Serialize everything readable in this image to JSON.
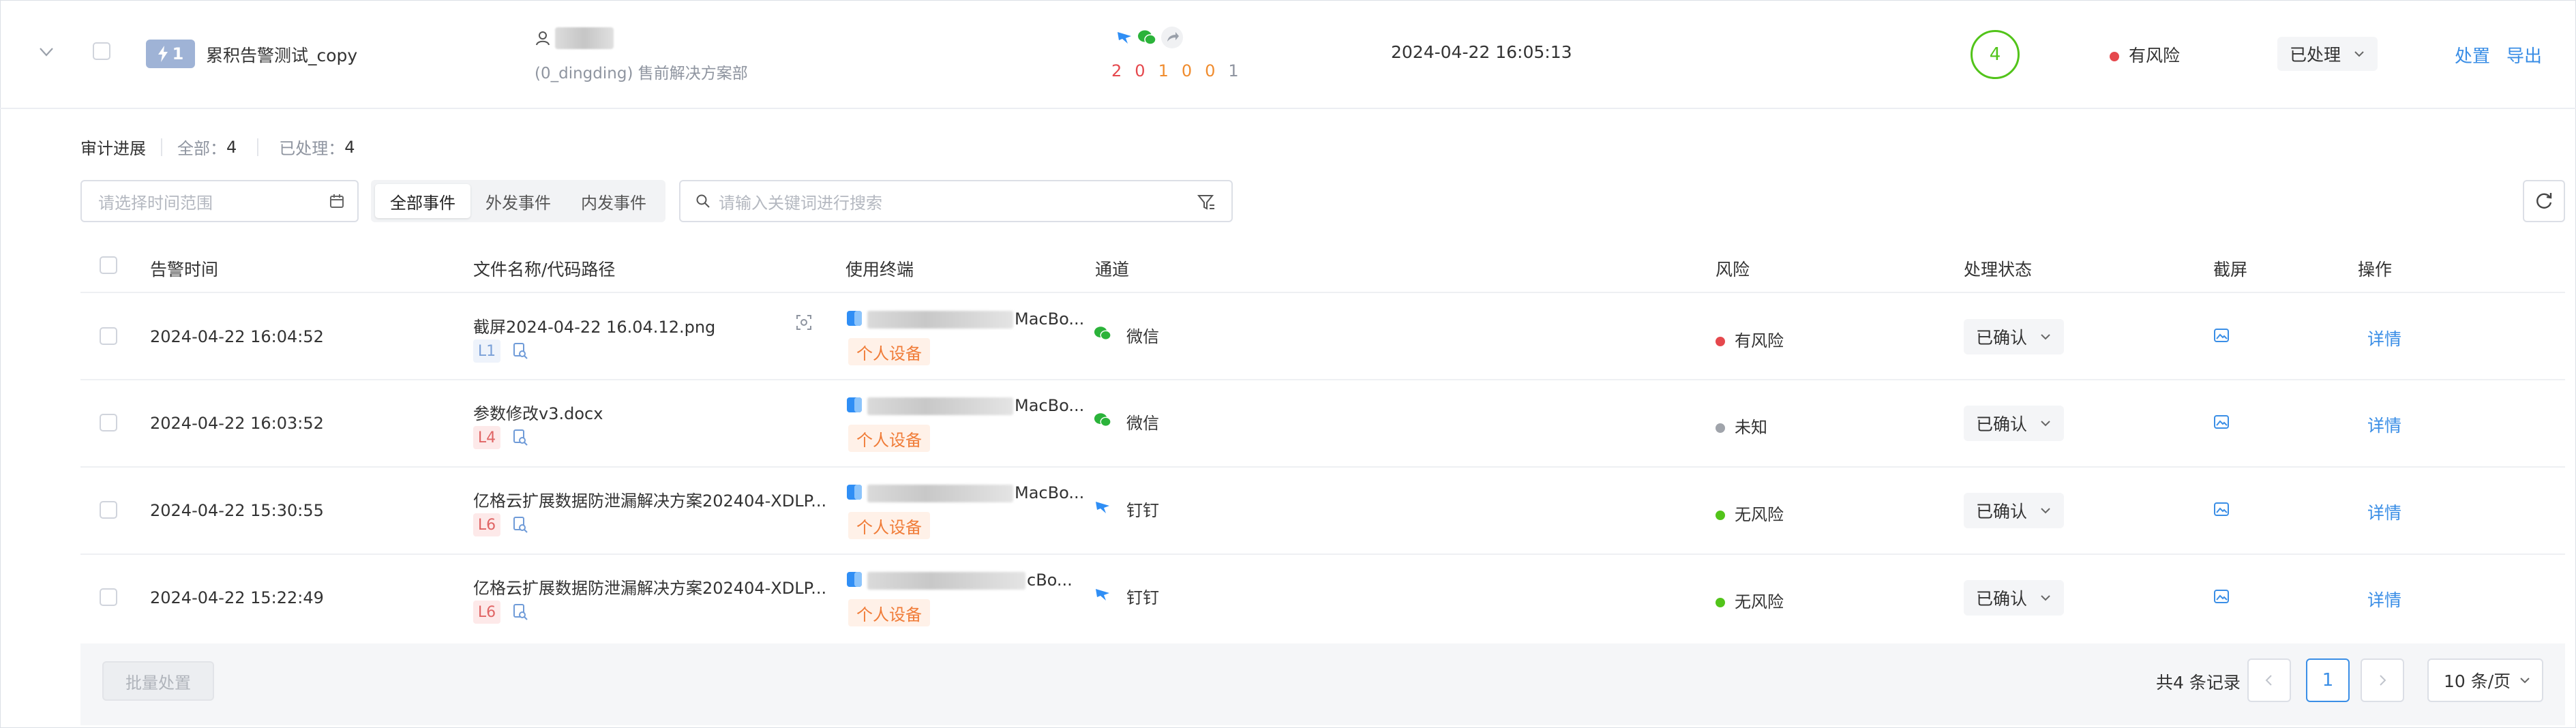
{
  "summary": {
    "level_badge": "1",
    "rule_name": "累积告警测试_copy",
    "dept": "(0_dingding) 售前解决方案部",
    "channel_counts": [
      "2",
      "0",
      "1",
      "0",
      "0",
      "1"
    ],
    "channel_count_colors": [
      "#e5484d",
      "#e5484d",
      "#f08c2e",
      "#f08c2e",
      "#f08c2e",
      "#8f95a0"
    ],
    "time": "2024-04-22 16:05:13",
    "event_count": "4",
    "risk": "有风险",
    "risk_color": "#e5484d",
    "status": "已处理",
    "action_handle": "处置",
    "action_export": "导出"
  },
  "progress": {
    "title": "审计进展",
    "total_label": "全部：",
    "total": "4",
    "done_label": "已处理：",
    "done": "4"
  },
  "filters": {
    "date_placeholder": "请选择时间范围",
    "tabs": [
      "全部事件",
      "外发事件",
      "内发事件"
    ],
    "active_tab": 0,
    "search_placeholder": "请输入关键词进行搜索"
  },
  "table": {
    "columns": [
      "告警时间",
      "文件名称/代码路径",
      "使用终端",
      "通道",
      "风险",
      "处理状态",
      "截屏",
      "操作"
    ],
    "rows": [
      {
        "time": "2024-04-22 16:04:52",
        "file": "截屏2024-04-22 16.04.12.png",
        "level": "L1",
        "level_style": "blue",
        "device_suffix": "MacBo...",
        "device_tag": "个人设备",
        "channel": "微信",
        "channel_icon": "wechat-icon",
        "risk": "有风险",
        "risk_color": "#e5484d",
        "status": "已确认",
        "detail": "详情"
      },
      {
        "time": "2024-04-22 16:03:52",
        "file": "参数修改v3.docx",
        "level": "L4",
        "level_style": "red",
        "device_suffix": "MacBo...",
        "device_tag": "个人设备",
        "channel": "微信",
        "channel_icon": "wechat-icon",
        "risk": "未知",
        "risk_color": "#a0a4ab",
        "status": "已确认",
        "detail": "详情"
      },
      {
        "time": "2024-04-22 15:30:55",
        "file": "亿格云扩展数据防泄漏解决方案202404-XDLP...",
        "level": "L6",
        "level_style": "red",
        "device_suffix": "MacBo...",
        "device_tag": "个人设备",
        "channel": "钉钉",
        "channel_icon": "dingtalk-icon",
        "risk": "无风险",
        "risk_color": "#52c41a",
        "status": "已确认",
        "detail": "详情"
      },
      {
        "time": "2024-04-22 15:22:49",
        "file": "亿格云扩展数据防泄漏解决方案202404-XDLP...",
        "level": "L6",
        "level_style": "red",
        "device_suffix": "cBo...",
        "device_tag": "个人设备",
        "channel": "钉钉",
        "channel_icon": "dingtalk-icon",
        "risk": "无风险",
        "risk_color": "#52c41a",
        "status": "已确认",
        "detail": "详情"
      }
    ]
  },
  "footer": {
    "batch_label": "批量处置",
    "total_records": "共4 条记录",
    "current_page": "1",
    "page_size": "10 条/页"
  },
  "colors": {
    "accent": "#3a8ee6",
    "green": "#52c41a",
    "red": "#e5484d"
  }
}
